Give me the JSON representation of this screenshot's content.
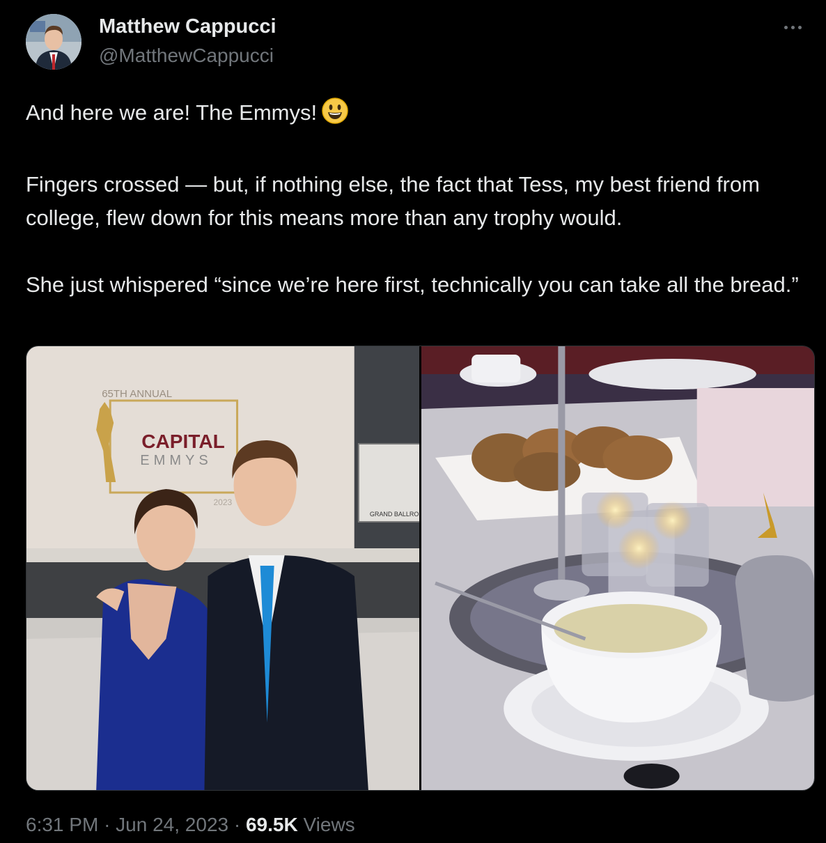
{
  "tweet": {
    "author_name": "Matthew Cappucci",
    "author_handle": "@MatthewCappucci",
    "text_line1": "And here we are! The Emmys!",
    "emoji": "smiling-face-with-open-mouth",
    "paragraph2": "Fingers crossed — but, if nothing else, the fact that Tess, my best friend from college, flew down for this means more than any trophy would.",
    "paragraph3": "She just whispered “since we’re here first, technically you can take all the bread.”",
    "time": "6:31 PM",
    "separator": "·",
    "date": "Jun 24, 2023",
    "views_count": "69.5K",
    "views_label": "Views"
  },
  "media": {
    "photo1": {
      "banner_edition": "65TH ANNUAL",
      "banner_title": "CAPITAL",
      "banner_subtitle": "EMMYS",
      "banner_year": "2023",
      "sign_text": "GRAND BALLROOM"
    }
  },
  "colors": {
    "background": "#000000",
    "text": "#e7e9ea",
    "secondary_text": "#71767b",
    "border": "#2f3336"
  }
}
